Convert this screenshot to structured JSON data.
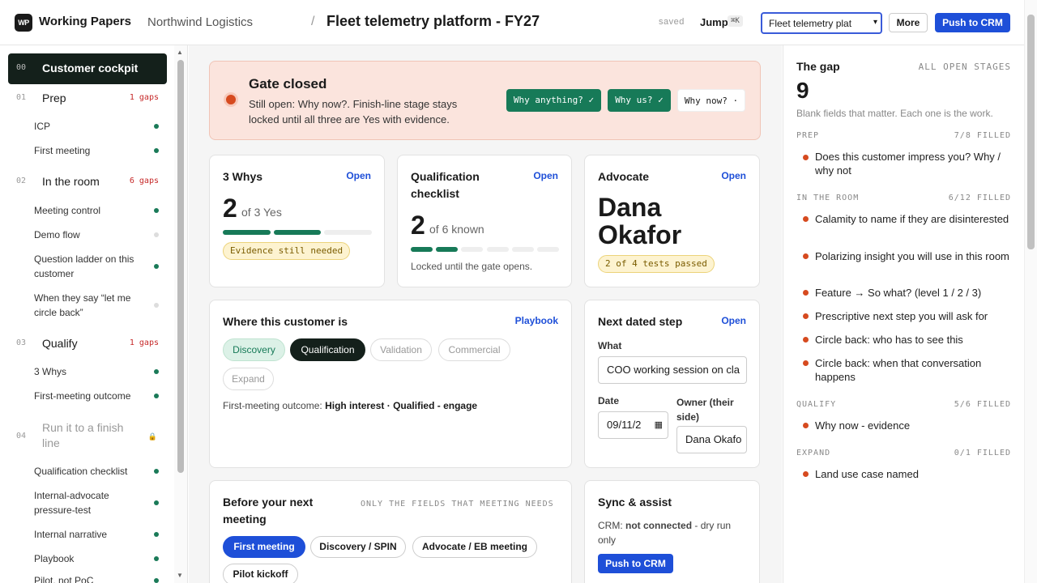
{
  "header": {
    "logo_text": "WP",
    "app_name": "Working Papers",
    "company": "Northwind Logistics",
    "separator": "/",
    "title": "Fleet telemetry platform - FY27",
    "saved": "saved",
    "jump_label": "Jump",
    "jump_shortcut": "⌘K",
    "select_value": "Fleet telemetry plat",
    "more_label": "More",
    "push_label": "Push to CRM"
  },
  "sidebar": {
    "sections": [
      {
        "num": "00",
        "label": "Customer cockpit",
        "gaps": "",
        "active": true
      },
      {
        "num": "01",
        "label": "Prep",
        "gaps": "1 gaps"
      },
      {
        "num": "02",
        "label": "In the room",
        "gaps": "6 gaps"
      },
      {
        "num": "03",
        "label": "Qualify",
        "gaps": "1 gaps"
      },
      {
        "num": "04",
        "label": "Run it to a finish line",
        "gaps": "",
        "locked": true
      }
    ],
    "items": [
      {
        "label": "ICP",
        "status": "done"
      },
      {
        "label": "First meeting",
        "status": "done"
      },
      {
        "label": "Meeting control",
        "status": "done"
      },
      {
        "label": "Demo flow",
        "status": "empty"
      },
      {
        "label": "Question ladder on this customer",
        "status": "done"
      },
      {
        "label": "When they say “let me circle back”",
        "status": "empty"
      },
      {
        "label": "3 Whys",
        "status": "done"
      },
      {
        "label": "First-meeting outcome",
        "status": "done"
      },
      {
        "label": "Qualification checklist",
        "status": "done"
      },
      {
        "label": "Internal-advocate pressure-test",
        "status": "done"
      },
      {
        "label": "Internal narrative",
        "status": "done"
      },
      {
        "label": "Playbook",
        "status": "done"
      },
      {
        "label": "Pilot, not PoC",
        "status": "done"
      }
    ]
  },
  "gate": {
    "title": "Gate closed",
    "text": "Still open: Why now?. Finish-line stage stays locked until all three are Yes with evidence.",
    "pills": [
      "Why anything? ✓",
      "Why us? ✓",
      "Why now? ·"
    ]
  },
  "whys": {
    "title": "3 Whys",
    "open": "Open",
    "num": "2",
    "of": "of 3 Yes",
    "progress": 0.6667,
    "tag": "Evidence still needed"
  },
  "qual": {
    "title": "Qualification checklist",
    "open": "Open",
    "num": "2",
    "of": "of 6 known",
    "progress": 0.3333,
    "note": "Locked until the gate opens."
  },
  "advocate": {
    "title": "Advocate",
    "open": "Open",
    "name": "Dana Okafor",
    "tag": "2 of 4 tests passed"
  },
  "where": {
    "title": "Where this customer is",
    "link": "Playbook",
    "stages": [
      "Discovery",
      "Qualification",
      "Validation",
      "Commercial",
      "Expand"
    ],
    "outcome_label": "First-meeting outcome:",
    "outcome_value": "High interest · Qualified - engage"
  },
  "next_step": {
    "title": "Next dated step",
    "open": "Open",
    "what_label": "What",
    "what_value": "COO working session on cla",
    "date_label": "Date",
    "date_value": "09/11/2",
    "owner_label": "Owner (their side)",
    "owner_value": "Dana Okafo"
  },
  "before": {
    "title": "Before your next meeting",
    "note": "ONLY THE FIELDS THAT MEETING NEEDS",
    "types": [
      "First meeting",
      "Discovery / SPIN",
      "Advocate / EB meeting",
      "Pilot kickoff"
    ]
  },
  "sync": {
    "title": "Sync & assist",
    "crm_label": "CRM:",
    "crm_status": "not connected",
    "crm_suffix": " - dry run only",
    "push_label": "Push to CRM"
  },
  "gap": {
    "title": "The gap",
    "all": "ALL OPEN STAGES",
    "count": "9",
    "sub": "Blank fields that matter. Each one is the work.",
    "groups": [
      {
        "name": "PREP",
        "count": "7/8 FILLED",
        "items": [
          "Does this customer impress you? Why / why not"
        ]
      },
      {
        "name": "IN THE ROOM",
        "count": "6/12 FILLED",
        "items": [
          "Calamity to name if they are disinterested",
          "Polarizing insight you will use in this room",
          "Feature → So what? (level 1 / 2 / 3)",
          "Prescriptive next step you will ask for",
          "Circle back: who has to see this",
          "Circle back: when that conversation happens"
        ]
      },
      {
        "name": "QUALIFY",
        "count": "5/6 FILLED",
        "items": [
          "Why now - evidence"
        ]
      },
      {
        "name": "EXPAND",
        "count": "0/1 FILLED",
        "items": [
          "Land use case named"
        ]
      }
    ]
  }
}
